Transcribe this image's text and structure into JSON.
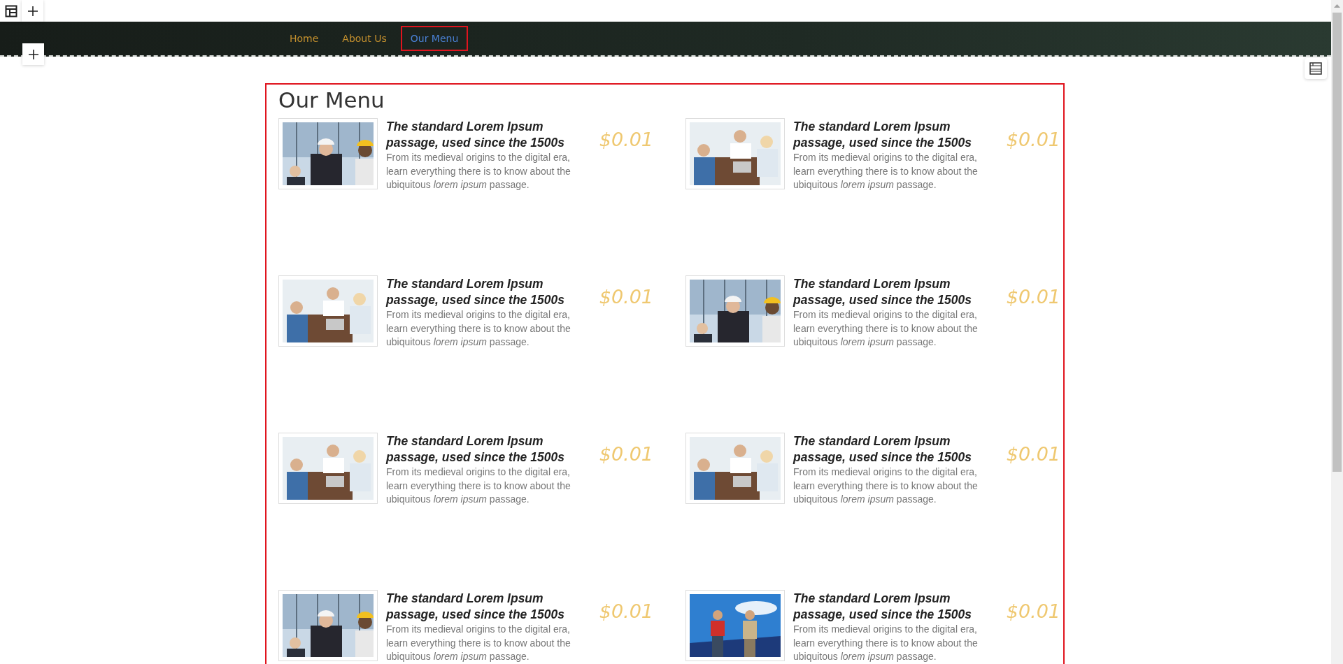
{
  "nav": {
    "items": [
      {
        "label": "Home",
        "selected": false
      },
      {
        "label": "About Us",
        "selected": false
      },
      {
        "label": "Our Menu",
        "selected": true
      }
    ]
  },
  "section": {
    "title": "Our Menu",
    "selected": true,
    "items": [
      {
        "title": "The standard Lorem Ipsum passage, used since the 1500s",
        "description": "From its medieval origins to the digital era, learn everything there is to know about the ubiquitous *lorem ipsum* passage.",
        "price": "$0.01",
        "kind": "picture"
      },
      {
        "title": "The standard Lorem Ipsum passage, used since the 1500s",
        "description": "From its medieval origins to the digital era, learn everything there is to know about the ubiquitous *lorem ipsum* passage.",
        "price": "$0.01",
        "kind": "picture"
      },
      {
        "title": "The standard Lorem Ipsum passage, used since the 1500s",
        "description": "From its medieval origins to the digital era, learn everything there is to know about the ubiquitous *lorem ipsum* passage.",
        "price": "$0.01",
        "kind": "picture"
      },
      {
        "title": "The standard Lorem Ipsum passage, used since the 1500s",
        "description": "From its medieval origins to the digital era, learn everything there is to know about the ubiquitous *lorem ipsum* passage.",
        "price": "$0.01",
        "kind": "picture"
      },
      {
        "title": "The standard Lorem Ipsum passage, used since the 1500s",
        "description": "From its medieval origins to the digital era, learn everything there is to know about the ubiquitous *lorem ipsum* passage.",
        "price": "$0.01",
        "kind": "picture"
      },
      {
        "title": "The standard Lorem Ipsum passage, used since the 1500s",
        "description": "From its medieval origins to the digital era, learn everything there is to know about the ubiquitous *lorem ipsum* passage.",
        "price": "$0.01",
        "kind": "picture"
      },
      {
        "title": "The standard Lorem Ipsum passage, used since the 1500s",
        "description": "From its medieval origins to the digital era, learn everything there is to know about the ubiquitous *lorem ipsum* passage.",
        "price": "$0.01",
        "kind": "picture"
      },
      {
        "title": "The standard Lorem Ipsum passage, used since the 1500s",
        "description": "From its medieval origins to the digital era, learn everything there is to know about the ubiquitous *lorem ipsum* passage.",
        "price": "$0.01",
        "kind": "picture"
      }
    ]
  }
}
